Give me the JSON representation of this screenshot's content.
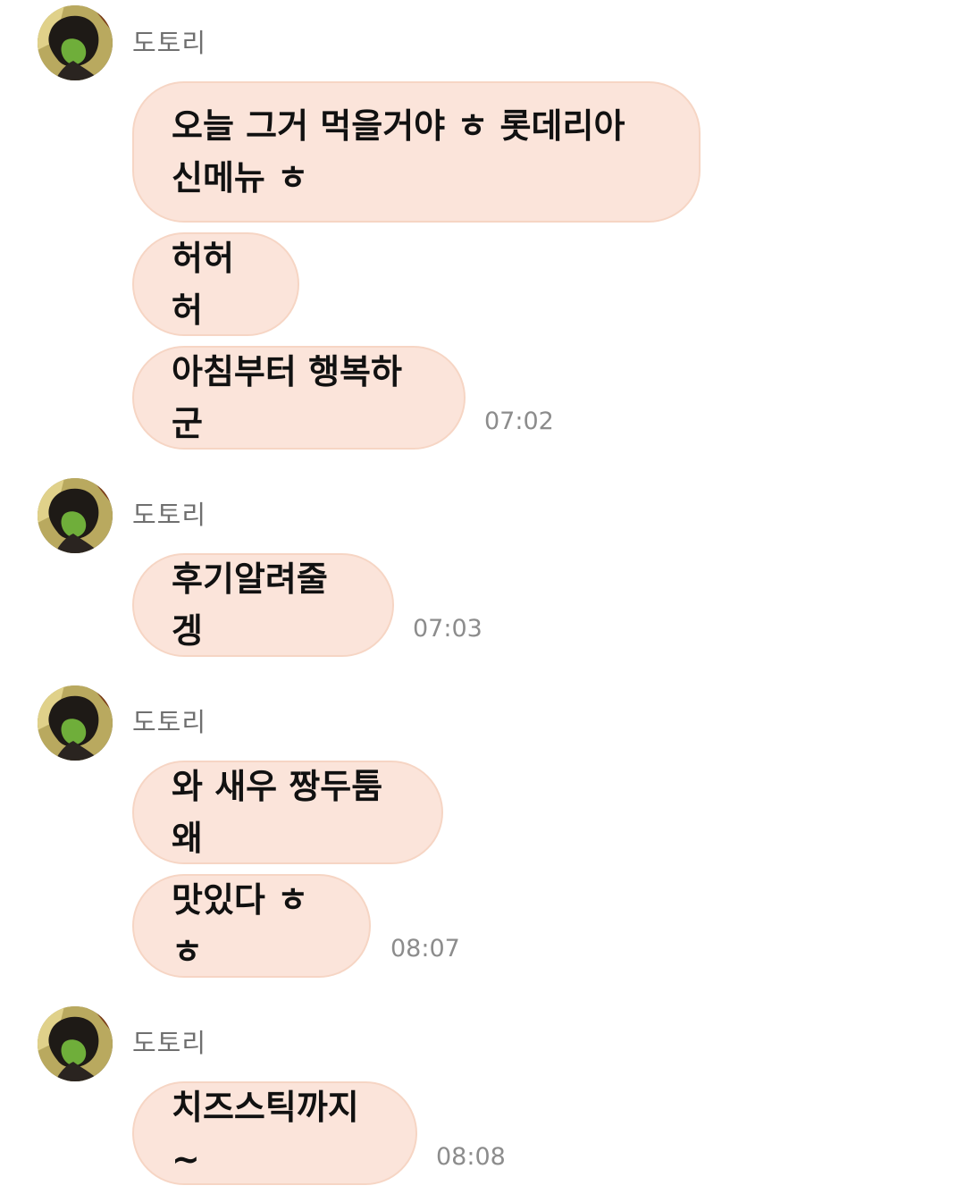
{
  "groups": [
    {
      "sender": "도토리",
      "messages": [
        {
          "text": "오늘 그거 먹을거야 ㅎ 롯데리아 신메뉴 ㅎ"
        },
        {
          "text": "허허허"
        },
        {
          "text": "아침부터 행복하군"
        }
      ],
      "time": "07:02"
    },
    {
      "sender": "도토리",
      "messages": [
        {
          "text": "후기알려줄겡"
        }
      ],
      "time": "07:03"
    },
    {
      "sender": "도토리",
      "messages": [
        {
          "text": "와 새우 짱두툼왜"
        },
        {
          "text": "맛있다 ㅎㅎ"
        }
      ],
      "time": "08:07"
    },
    {
      "sender": "도토리",
      "messages": [
        {
          "text": "치즈스틱까지~"
        }
      ],
      "time": "08:08"
    }
  ],
  "colors": {
    "bubble_bg": "#fbe4da",
    "bubble_border": "#f6d5c4",
    "sender_text": "#6f6f6f",
    "time_text": "#8c8c8c"
  }
}
